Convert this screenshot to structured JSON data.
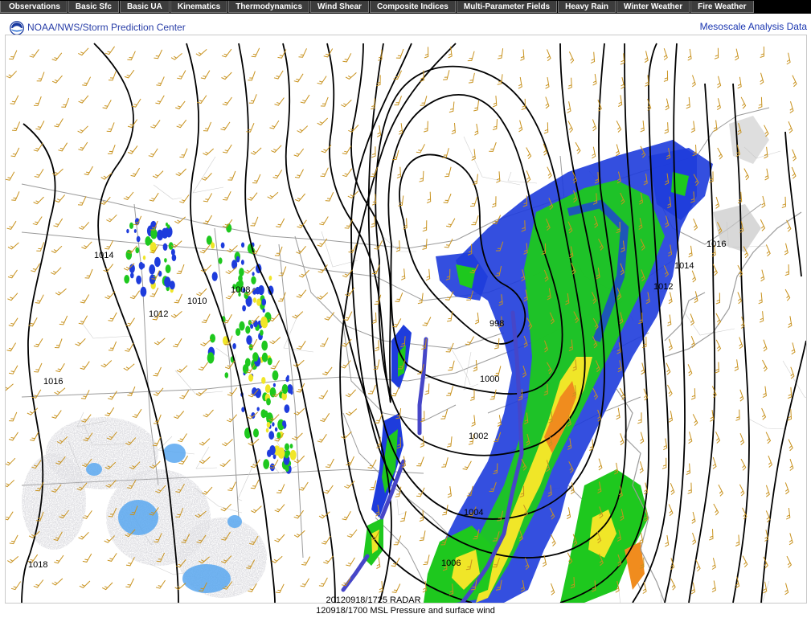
{
  "nav": {
    "items": [
      {
        "label": "Observations"
      },
      {
        "label": "Basic Sfc"
      },
      {
        "label": "Basic UA"
      },
      {
        "label": "Kinematics"
      },
      {
        "label": "Thermodynamics"
      },
      {
        "label": "Wind Shear"
      },
      {
        "label": "Composite Indices"
      },
      {
        "label": "Multi-Parameter Fields"
      },
      {
        "label": "Heavy Rain"
      },
      {
        "label": "Winter Weather"
      },
      {
        "label": "Fire Weather"
      }
    ]
  },
  "header": {
    "org_title": "NOAA/NWS/Storm Prediction Center",
    "meso_link": "Mesoscale Analysis Data"
  },
  "map": {
    "radar_caption": "20120918/1725 RADAR",
    "product_caption": "120918/1700 MSL Pressure and surface wind",
    "isobar_labels": [
      "1014",
      "1008",
      "1010",
      "1012",
      "1016",
      "1018",
      "998",
      "1000",
      "1002",
      "1004",
      "1006",
      "1012",
      "1014",
      "1016"
    ],
    "colors": {
      "isobar": "#000000",
      "front": "#4646c8",
      "wind_barb": "#c8921e",
      "radar_light": "#9fe08f",
      "radar_green": "#1ec81e",
      "radar_blue": "#1e3cdc",
      "radar_yellow": "#f0e628",
      "radar_orange": "#f08c1e",
      "boundaries": "#9b9b9b"
    }
  }
}
